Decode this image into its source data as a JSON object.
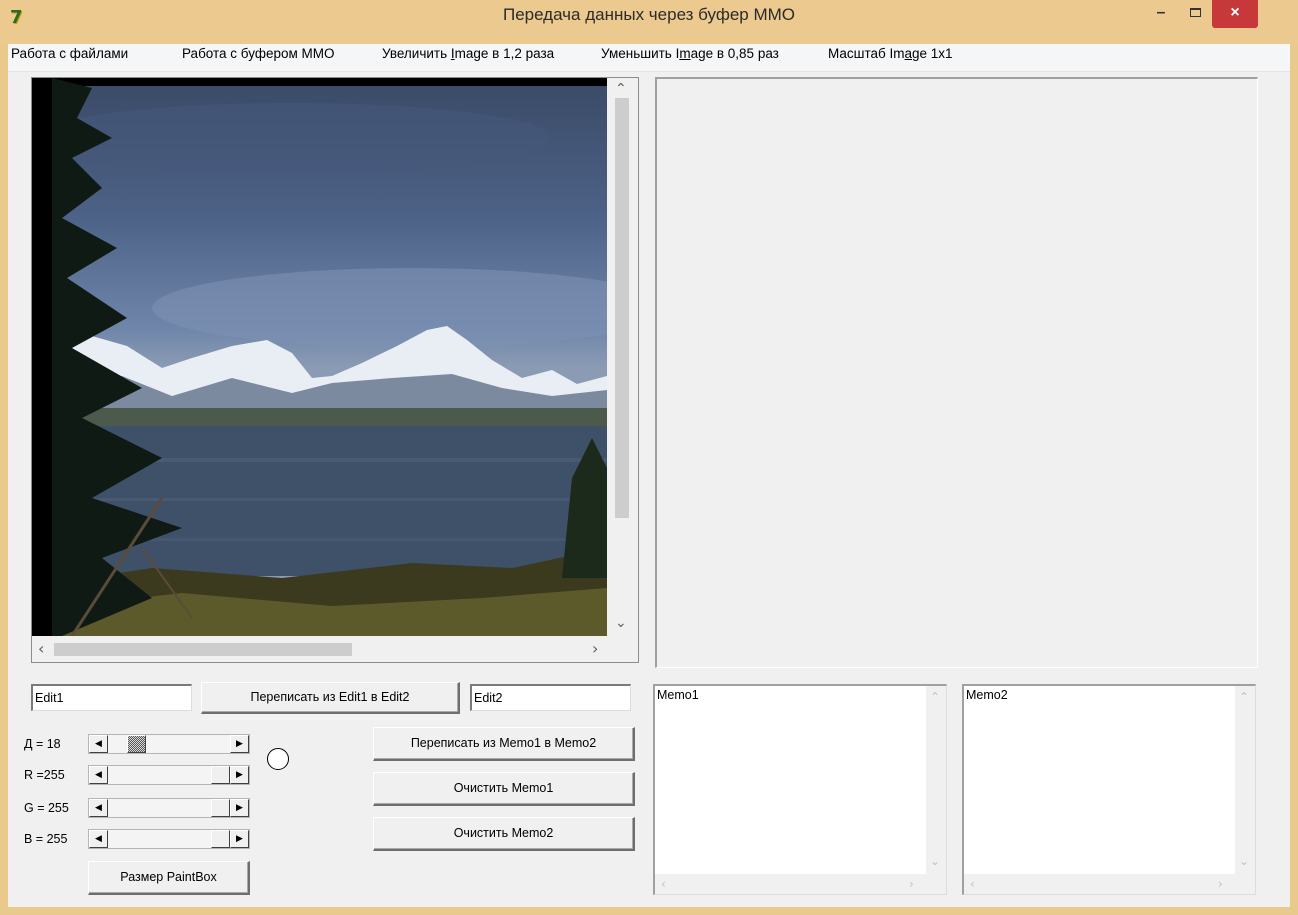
{
  "window": {
    "title": "Передача данных через буфер ММО",
    "min_glyph": "–",
    "close_glyph": "×"
  },
  "menu": {
    "files": "Работа с файлами",
    "mmo": "Работа с буфером ММО",
    "zoom_in_pre": "Увеличить ",
    "zoom_in_u": "I",
    "zoom_in_post": "mage в 1,2 раза",
    "zoom_out_pre": "Уменьшить I",
    "zoom_out_u": "m",
    "zoom_out_post": "age в 0,85 раз",
    "scale_pre": "Масштаб  Im",
    "scale_u": "a",
    "scale_post": "ge 1x1"
  },
  "edits": {
    "edit1": "Edit1",
    "edit2": "Edit2",
    "copy_button": "Переписать из Edit1 в Edit2"
  },
  "sliders": [
    {
      "label": "Д = 18",
      "value": 18,
      "max": 100
    },
    {
      "label": "R =255",
      "value": 255,
      "max": 255
    },
    {
      "label": "G = 255",
      "value": 255,
      "max": 255
    },
    {
      "label": "B = 255",
      "value": 255,
      "max": 255
    }
  ],
  "buttons": {
    "copy_memo": "Переписать из Memo1 в Memo2",
    "clear_memo1": "Очистить Memo1",
    "clear_memo2": "Очистить Memo2",
    "paintbox_size": "Размер PaintBox"
  },
  "memos": {
    "memo1": "Memo1",
    "memo2": "Memo2"
  },
  "icons": {
    "up": "⌃",
    "down": "⌄",
    "left": "‹",
    "right": "›",
    "sb_left": "◀",
    "sb_right": "▶"
  }
}
